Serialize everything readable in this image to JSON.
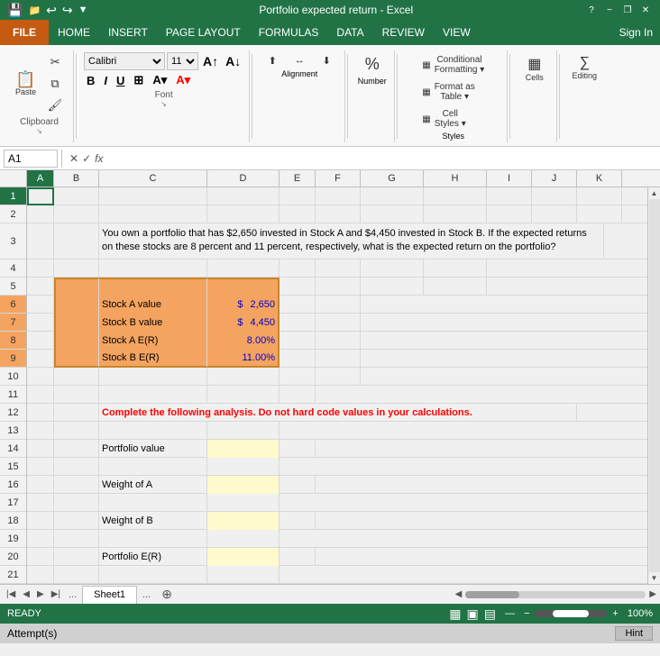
{
  "titleBar": {
    "title": "Portfolio expected return - Excel",
    "helpIcon": "?",
    "minIcon": "−",
    "restoreIcon": "❐",
    "closeIcon": "✕"
  },
  "menuBar": {
    "fileLabel": "FILE",
    "items": [
      "HOME",
      "INSERT",
      "PAGE LAYOUT",
      "FORMULAS",
      "DATA",
      "REVIEW",
      "VIEW"
    ],
    "signIn": "Sign In"
  },
  "ribbon": {
    "groups": [
      {
        "name": "Clipboard",
        "buttons": [
          {
            "label": "Paste",
            "icon": "📋"
          },
          {
            "label": "Cut",
            "icon": "✂"
          },
          {
            "label": "Copy",
            "icon": "⧉"
          },
          {
            "label": "Format Painter",
            "icon": "🖌"
          }
        ]
      },
      {
        "name": "Font",
        "fontName": "Calibri",
        "fontSize": "11",
        "buttons": [
          "B",
          "I",
          "U"
        ]
      },
      {
        "name": "Alignment",
        "label": "Alignment"
      },
      {
        "name": "Number",
        "label": "Number"
      },
      {
        "name": "Styles",
        "items": [
          "Conditional Formatting ▾",
          "Format as Table ▾",
          "Cell Styles ▾"
        ]
      },
      {
        "name": "Cells",
        "label": "Cells"
      },
      {
        "name": "Editing",
        "label": "Editing"
      }
    ]
  },
  "formulaBar": {
    "cellRef": "A1",
    "formula": ""
  },
  "columns": [
    "A",
    "B",
    "C",
    "D",
    "E",
    "F",
    "G",
    "H",
    "I",
    "J",
    "K"
  ],
  "rows": [
    1,
    2,
    3,
    4,
    5,
    6,
    7,
    8,
    9,
    10,
    11,
    12,
    13,
    14,
    15,
    16,
    17,
    18,
    19,
    20,
    21
  ],
  "spreadsheet": {
    "row3_text": "You own a portfolio that has $2,650 invested in Stock A and $4,450 invested in Stock B. If the expected returns on these stocks are 8 percent and 11 percent, respectively, what is the expected return on the portfolio?",
    "row6_label": "Stock A value",
    "row6_dollar": "$",
    "row6_value": "2,650",
    "row7_label": "Stock B value",
    "row7_dollar": "$",
    "row7_value": "4,450",
    "row8_label": "Stock A E(R)",
    "row8_value": "8.00%",
    "row9_label": "Stock B E(R)",
    "row9_value": "11.00%",
    "row12_text": "Complete the following analysis. Do not hard code values in your calculations.",
    "row14_label": "Portfolio value",
    "row16_label": "Weight of A",
    "row18_label": "Weight of B",
    "row20_label": "Portfolio E(R)"
  },
  "sheetTabs": {
    "active": "Sheet1",
    "tabs": [
      "Sheet1"
    ]
  },
  "statusBar": {
    "ready": "READY",
    "viewIcons": [
      "▦",
      "▣",
      "▤"
    ],
    "zoom": "100%",
    "zoomSlider": 100
  },
  "bottomBar": {
    "attempts": "Attempt(s)",
    "hint": "Hint"
  }
}
